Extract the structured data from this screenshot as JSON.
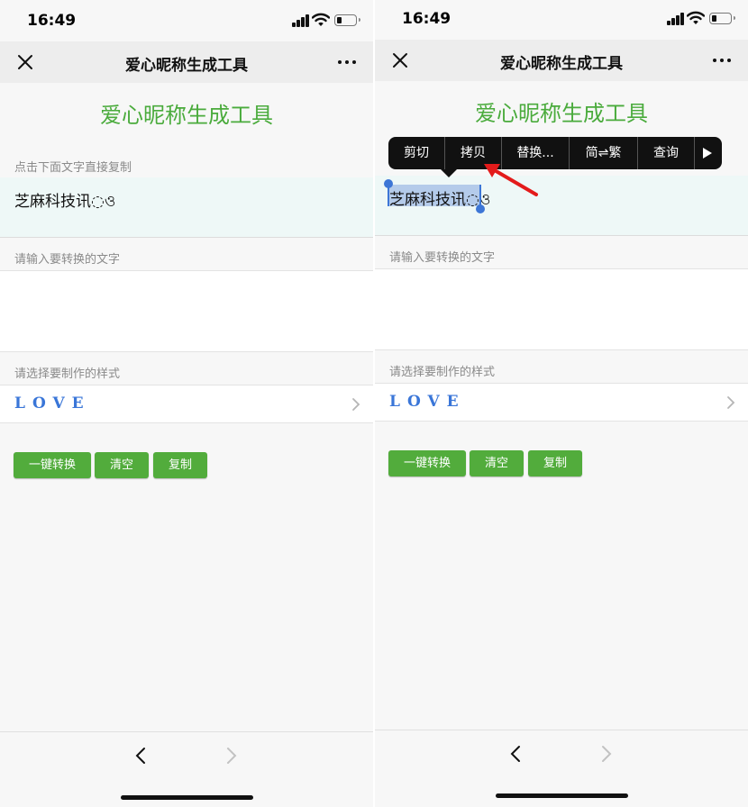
{
  "status": {
    "time": "16:49"
  },
  "nav": {
    "title": "爱心昵称生成工具"
  },
  "page": {
    "heading": "爱心昵称生成工具",
    "copy_label": "点击下面文字直接复制",
    "result_text": "芝麻科技讯◌ও",
    "input_label": "请输入要转换的文字",
    "style_label": "请选择要制作的样式",
    "style_value": "LOVE"
  },
  "buttons": {
    "convert": "一键转换",
    "clear": "清空",
    "copy": "复制"
  },
  "context_menu": {
    "items": [
      "剪切",
      "拷贝",
      "替换...",
      "简⇌繁",
      "查询"
    ]
  },
  "colors": {
    "accent_green": "#4aab3c",
    "button_green": "#52ac3c",
    "result_bg": "#eef8f7",
    "selection_blue": "#3d76d6",
    "annotation_red": "#e31b1b"
  },
  "icons": [
    "close-icon",
    "more-icon",
    "chevron-right-icon",
    "back-arrow-icon",
    "forward-arrow-icon",
    "signal-icon",
    "wifi-icon",
    "battery-icon",
    "play-more-icon",
    "red-arrow-annotation"
  ]
}
